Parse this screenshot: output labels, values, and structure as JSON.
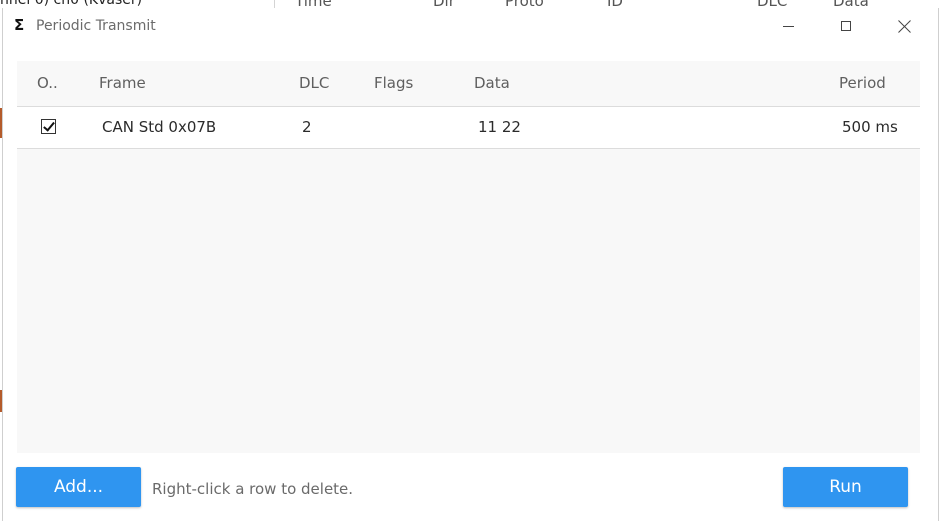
{
  "background_window": {
    "left_text": "nnel 0) ch0 (Kvaser)",
    "columns": [
      "Time",
      "Dir",
      "Proto",
      "ID",
      "DLC",
      "Data"
    ]
  },
  "dialog": {
    "title": "Periodic Transmit",
    "title_icon": "sigma-icon",
    "window_controls": {
      "minimize": "minimize-icon",
      "maximize": "maximize-icon",
      "close": "close-icon"
    }
  },
  "table": {
    "columns": {
      "on": "O..",
      "frame": "Frame",
      "dlc": "DLC",
      "flags": "Flags",
      "data": "Data",
      "period": "Period"
    },
    "rows": [
      {
        "enabled": true,
        "frame": "CAN Std 0x07B",
        "dlc": "2",
        "flags": "",
        "data": "11 22",
        "period": "500 ms"
      }
    ]
  },
  "footer": {
    "add_label": "Add...",
    "hint": "Right-click a row to delete.",
    "run_label": "Run"
  },
  "colors": {
    "accent": "#2f95f0",
    "panel_bg": "#f8f8f8"
  }
}
